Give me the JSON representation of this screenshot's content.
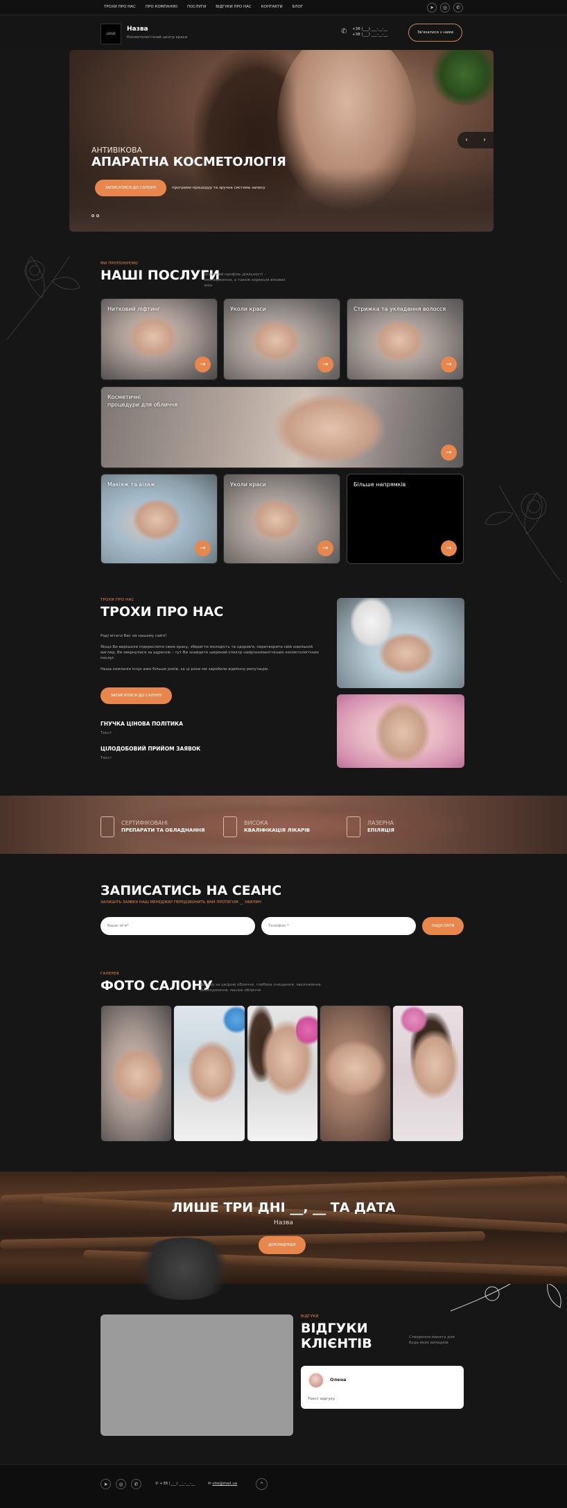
{
  "topnav": {
    "items": [
      "ТРОХИ ПРО НАС",
      "ПРО КОМПАНІЮ",
      "ПОСЛУГИ",
      "ВІДГУКИ ПРО НАС",
      "КОНТАКТИ",
      "БЛОГ"
    ],
    "socials": [
      "telegram-icon",
      "instagram-icon",
      "whatsapp-icon"
    ]
  },
  "header": {
    "logo": "LOGO",
    "name": "Назва",
    "subtitle": "Косметологічний центр краси",
    "phone1": "+38 (___) ___-__-__",
    "phone2": "+38 (___) ___-__-__",
    "contact_button": "Зв'язатися з нами"
  },
  "hero": {
    "small": "АНТИВІКОВА",
    "title": "АПАРАТНА КОСМЕТОЛОГІЯ",
    "button": "ЗАПИСАТИСЯ ДО САЛОНУ",
    "note": "програми процедур та зручна система запису",
    "prev": "‹",
    "next": "›"
  },
  "services": {
    "kicker": "МИ ПРОПОНУЄМО",
    "title": "НАШІ ПОСЛУГИ",
    "subtitle": "Основний профіль діяльності - омолодження, а також корекція вікових змін",
    "cards": [
      "Нитковий ліфтинг",
      "Уколи краси",
      "Стрижка та укладання волосся",
      "Косметичні\nпроцедури для обличчя",
      "Макіяж та візаж",
      "Уколи краси",
      "Більше напрямків"
    ],
    "arrow": "→"
  },
  "about": {
    "kicker": "ТРОХИ ПРО НАС",
    "title": "ТРОХИ ПРО НАС",
    "p1": "Раді вітати Вас на нашому сайті!",
    "p2": "Якщо Ви вирішили підкреслити свою красу, зберегти молодість та здоров'я, перетворити свій зовнішній вигляд, Ви звернулися за адресою – тут Ви знайдете широкий спектр найрізноманітніших косметологічних послуг.",
    "p3": "Наша компанія існує вже більше років, за ці роки ми заробили відмінну репутацію.",
    "button": "ЗАПИСАТИСЯ ДО САЛОНУ",
    "feature1_title": "ГНУЧКА ЦІНОВА ПОЛІТИКА",
    "feature1_text": "Текст",
    "feature2_title": "ЦІЛОДОБОВИЙ ПРИЙОМ ЗАЯВОК",
    "feature2_text": "Текст"
  },
  "stats": [
    {
      "top": "СЕРТИФІКОВАНІ",
      "bottom": "ПРЕПАРАТИ ТА ОБЛАДНАННЯ"
    },
    {
      "top": "ВИСОКА",
      "bottom": "КВАЛІФІКАЦІЯ ЛІКАРІВ"
    },
    {
      "top": "ЛАЗЕРНА",
      "bottom": "ЕПІЛЯЦІЯ"
    }
  ],
  "booking": {
    "title": "ЗАПИСАТИСЬ НА СЕАНС",
    "subtitle": "ЗАЛИШІТЬ ЗАЯВКУ НАШ МЕНЕДЖЕР ПЕРЕДЗВОНИТЬ ВАМ ПРОТЯГОМ __ ХВИЛИН",
    "name_placeholder": "Ваше ім'я*",
    "phone_placeholder": "Телефон *",
    "submit": "НАДІСЛАТИ"
  },
  "gallery": {
    "kicker": "ГАЛЕРЕЯ",
    "title": "ФОТО САЛОНУ",
    "subtitle": "Догляд за шкірою обличчя: глибоке очищення, зволоження, омолодження, масаж обличчя"
  },
  "promo": {
    "title": "ЛИШЕ ТРИ ДНІ __, __ ТА ДАТА",
    "subtitle": "Назва",
    "button": "ДОКЛАДНІШЕ"
  },
  "reviews": {
    "kicker": "ВІДГУКИ",
    "title_line1": "ВІДГУКИ",
    "title_line2": "КЛІЄНТІВ",
    "subtitle": "Створення макету для будь-яких випадків",
    "name": "Олена",
    "text": "Текст відгуку"
  },
  "footer": {
    "phone": "+38 (___) ___-__-__",
    "email": "site@mail.ua",
    "up": "^"
  }
}
